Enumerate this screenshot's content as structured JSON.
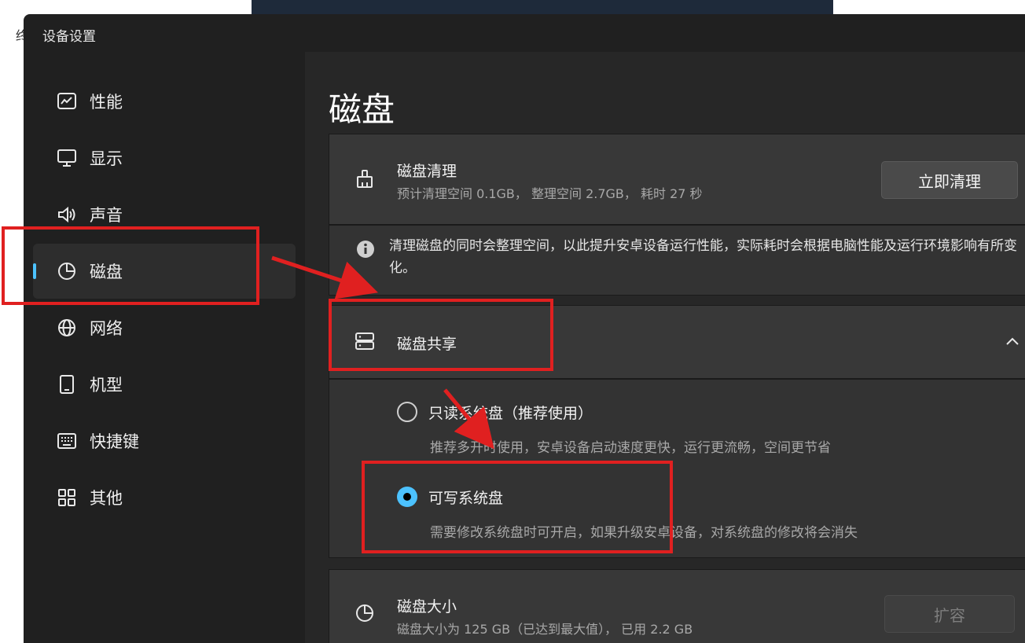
{
  "window": {
    "title": "设备设置"
  },
  "sidebar": {
    "items": [
      {
        "label": "性能",
        "icon": "performance-icon"
      },
      {
        "label": "显示",
        "icon": "monitor-icon"
      },
      {
        "label": "声音",
        "icon": "speaker-icon"
      },
      {
        "label": "磁盘",
        "icon": "pie-chart-icon",
        "active": true
      },
      {
        "label": "网络",
        "icon": "globe-icon"
      },
      {
        "label": "机型",
        "icon": "phone-icon"
      },
      {
        "label": "快捷键",
        "icon": "keyboard-icon"
      },
      {
        "label": "其他",
        "icon": "grid-icon"
      }
    ]
  },
  "main": {
    "title": "磁盘",
    "cleanup": {
      "title": "磁盘清理",
      "subtitle": "预计清理空间 0.1GB， 整理空间 2.7GB， 耗时 27 秒",
      "button": "立即清理",
      "info": "清理磁盘的同时会整理空间，以此提升安卓设备运行性能，实际耗时会根据电脑性能及运行环境影响有所变化。"
    },
    "share": {
      "title": "磁盘共享",
      "expanded": true,
      "options": [
        {
          "label": "只读系统盘（推荐使用）",
          "desc": "推荐多开时使用，安卓设备启动速度更快，运行更流畅，空间更节省",
          "selected": false
        },
        {
          "label": "可写系统盘",
          "desc": "需要修改系统盘时可开启，如果升级安卓设备，对系统盘的修改将会消失",
          "selected": true
        }
      ]
    },
    "size": {
      "title": "磁盘大小",
      "subtitle": "磁盘大小为 125 GB（已达到最大值）， 已用 2.2 GB",
      "button": "扩容",
      "button_disabled": true
    }
  },
  "background": {
    "left_char": "终"
  },
  "colors": {
    "accent": "#4cc2ff",
    "annotation": "#e02020"
  }
}
